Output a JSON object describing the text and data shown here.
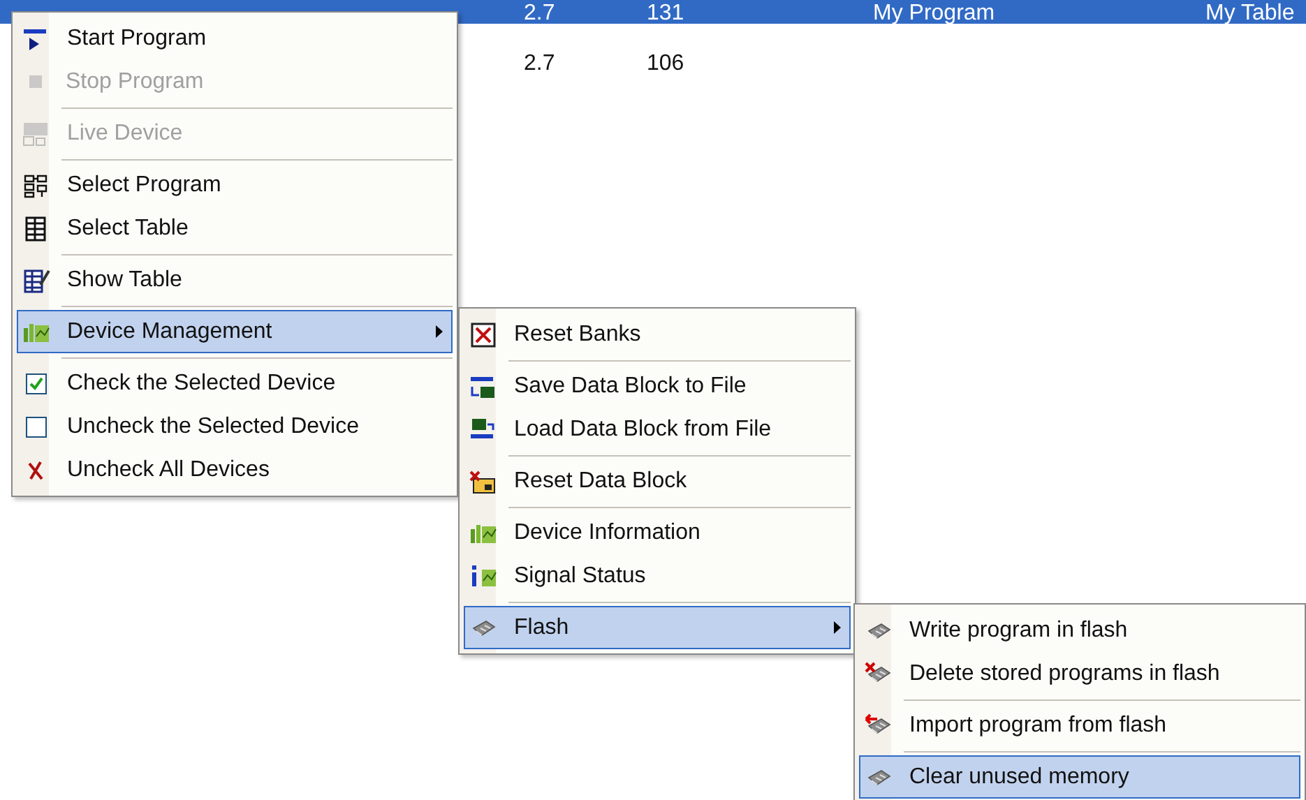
{
  "table": {
    "rows": [
      {
        "cells": [
          "2.7",
          "131",
          "My Program",
          "My Table"
        ],
        "selected": true
      },
      {
        "cells": [
          "2.7",
          "106",
          "",
          ""
        ],
        "selected": false
      }
    ]
  },
  "menus": [
    {
      "items": [
        {
          "kind": "item",
          "label": "Start Program",
          "disabled": false,
          "selected": false,
          "submenu": false
        },
        {
          "kind": "item",
          "label": "Stop Program",
          "disabled": true,
          "selected": false,
          "submenu": false
        },
        {
          "kind": "separator"
        },
        {
          "kind": "item",
          "label": "Live Device",
          "disabled": true,
          "selected": false,
          "submenu": false
        },
        {
          "kind": "separator"
        },
        {
          "kind": "item",
          "label": "Select Program",
          "disabled": false,
          "selected": false,
          "submenu": false
        },
        {
          "kind": "item",
          "label": "Select Table",
          "disabled": false,
          "selected": false,
          "submenu": false
        },
        {
          "kind": "separator"
        },
        {
          "kind": "item",
          "label": "Show Table",
          "disabled": false,
          "selected": false,
          "submenu": false
        },
        {
          "kind": "separator"
        },
        {
          "kind": "item",
          "label": "Device Management",
          "disabled": false,
          "selected": true,
          "submenu": true
        },
        {
          "kind": "separator"
        },
        {
          "kind": "item",
          "label": "Check the Selected Device",
          "disabled": false,
          "selected": false,
          "submenu": false
        },
        {
          "kind": "item",
          "label": "Uncheck the Selected Device",
          "disabled": false,
          "selected": false,
          "submenu": false
        },
        {
          "kind": "item",
          "label": "Uncheck All Devices",
          "disabled": false,
          "selected": false,
          "submenu": false
        }
      ]
    },
    {
      "items": [
        {
          "kind": "item",
          "label": "Reset Banks",
          "disabled": false,
          "selected": false,
          "submenu": false
        },
        {
          "kind": "separator"
        },
        {
          "kind": "item",
          "label": "Save Data Block to File",
          "disabled": false,
          "selected": false,
          "submenu": false
        },
        {
          "kind": "item",
          "label": "Load Data Block from File",
          "disabled": false,
          "selected": false,
          "submenu": false
        },
        {
          "kind": "separator"
        },
        {
          "kind": "item",
          "label": "Reset Data Block",
          "disabled": false,
          "selected": false,
          "submenu": false
        },
        {
          "kind": "separator"
        },
        {
          "kind": "item",
          "label": "Device Information",
          "disabled": false,
          "selected": false,
          "submenu": false
        },
        {
          "kind": "item",
          "label": "Signal Status",
          "disabled": false,
          "selected": false,
          "submenu": false
        },
        {
          "kind": "separator"
        },
        {
          "kind": "item",
          "label": "Flash",
          "disabled": false,
          "selected": true,
          "submenu": true
        }
      ]
    },
    {
      "items": [
        {
          "kind": "item",
          "label": "Write program in flash",
          "disabled": false,
          "selected": false,
          "submenu": false
        },
        {
          "kind": "item",
          "label": "Delete stored programs in flash",
          "disabled": false,
          "selected": false,
          "submenu": false
        },
        {
          "kind": "separator"
        },
        {
          "kind": "item",
          "label": "Import program from flash",
          "disabled": false,
          "selected": false,
          "submenu": false
        },
        {
          "kind": "separator"
        },
        {
          "kind": "item",
          "label": "Clear unused memory",
          "disabled": false,
          "selected": true,
          "submenu": false
        }
      ]
    }
  ]
}
